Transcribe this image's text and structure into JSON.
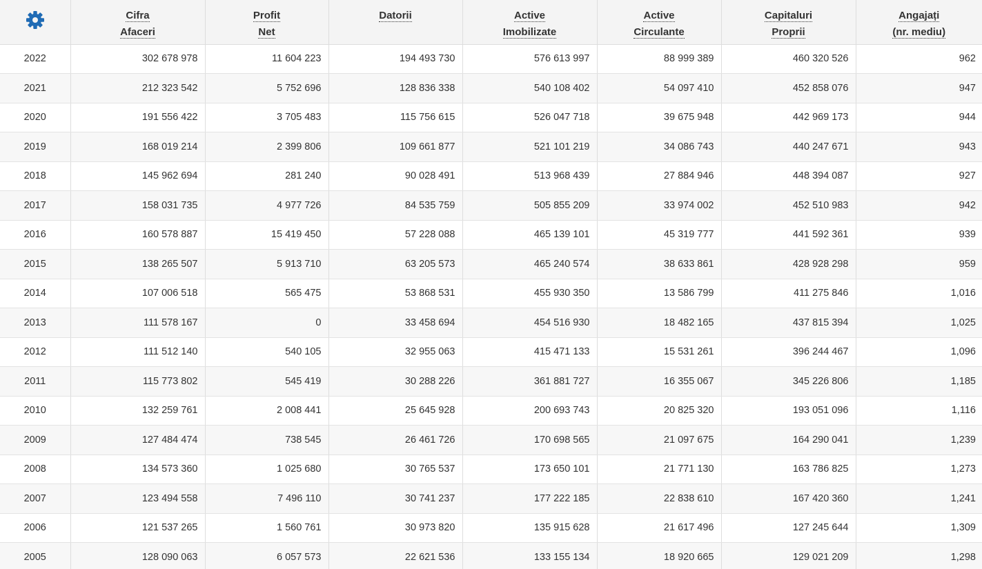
{
  "table": {
    "settings_icon": "gear-icon",
    "accent_color": "#1f6bb5",
    "headers": [
      {
        "line1": "Cifra",
        "line2": "Afaceri"
      },
      {
        "line1": "Profit",
        "line2": "Net"
      },
      {
        "line1": "Datorii",
        "line2": ""
      },
      {
        "line1": "Active",
        "line2": "Imobilizate"
      },
      {
        "line1": "Active",
        "line2": "Circulante"
      },
      {
        "line1": "Capitaluri",
        "line2": "Proprii"
      },
      {
        "line1": "Angajați",
        "line2": "(nr. mediu)"
      }
    ],
    "rows": [
      [
        "2022",
        "302 678 978",
        "11 604 223",
        "194 493 730",
        "576 613 997",
        "88 999 389",
        "460 320 526",
        "962"
      ],
      [
        "2021",
        "212 323 542",
        "5 752 696",
        "128 836 338",
        "540 108 402",
        "54 097 410",
        "452 858 076",
        "947"
      ],
      [
        "2020",
        "191 556 422",
        "3 705 483",
        "115 756 615",
        "526 047 718",
        "39 675 948",
        "442 969 173",
        "944"
      ],
      [
        "2019",
        "168 019 214",
        "2 399 806",
        "109 661 877",
        "521 101 219",
        "34 086 743",
        "440 247 671",
        "943"
      ],
      [
        "2018",
        "145 962 694",
        "281 240",
        "90 028 491",
        "513 968 439",
        "27 884 946",
        "448 394 087",
        "927"
      ],
      [
        "2017",
        "158 031 735",
        "4 977 726",
        "84 535 759",
        "505 855 209",
        "33 974 002",
        "452 510 983",
        "942"
      ],
      [
        "2016",
        "160 578 887",
        "15 419 450",
        "57 228 088",
        "465 139 101",
        "45 319 777",
        "441 592 361",
        "939"
      ],
      [
        "2015",
        "138 265 507",
        "5 913 710",
        "63 205 573",
        "465 240 574",
        "38 633 861",
        "428 928 298",
        "959"
      ],
      [
        "2014",
        "107 006 518",
        "565 475",
        "53 868 531",
        "455 930 350",
        "13 586 799",
        "411 275 846",
        "1,016"
      ],
      [
        "2013",
        "111 578 167",
        "0",
        "33 458 694",
        "454 516 930",
        "18 482 165",
        "437 815 394",
        "1,025"
      ],
      [
        "2012",
        "111 512 140",
        "540 105",
        "32 955 063",
        "415 471 133",
        "15 531 261",
        "396 244 467",
        "1,096"
      ],
      [
        "2011",
        "115 773 802",
        "545 419",
        "30 288 226",
        "361 881 727",
        "16 355 067",
        "345 226 806",
        "1,185"
      ],
      [
        "2010",
        "132 259 761",
        "2 008 441",
        "25 645 928",
        "200 693 743",
        "20 825 320",
        "193 051 096",
        "1,116"
      ],
      [
        "2009",
        "127 484 474",
        "738 545",
        "26 461 726",
        "170 698 565",
        "21 097 675",
        "164 290 041",
        "1,239"
      ],
      [
        "2008",
        "134 573 360",
        "1 025 680",
        "30 765 537",
        "173 650 101",
        "21 771 130",
        "163 786 825",
        "1,273"
      ],
      [
        "2007",
        "123 494 558",
        "7 496 110",
        "30 741 237",
        "177 222 185",
        "22 838 610",
        "167 420 360",
        "1,241"
      ],
      [
        "2006",
        "121 537 265",
        "1 560 761",
        "30 973 820",
        "135 915 628",
        "21 617 496",
        "127 245 644",
        "1,309"
      ],
      [
        "2005",
        "128 090 063",
        "6 057 573",
        "22 621 536",
        "133 155 134",
        "18 920 665",
        "129 021 209",
        "1,298"
      ]
    ]
  }
}
